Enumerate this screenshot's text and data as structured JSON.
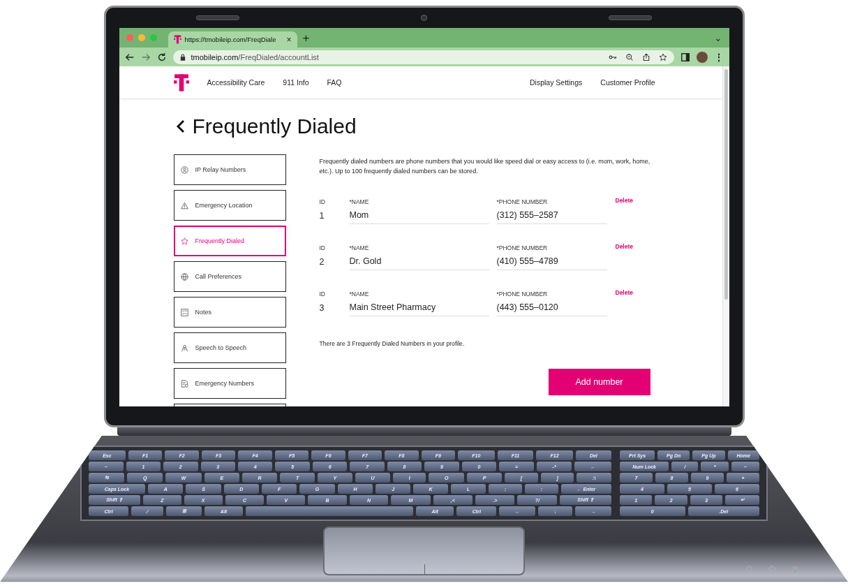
{
  "browser": {
    "tab": {
      "title": "https://tmobileip.com/FreqDiale",
      "close": "×"
    },
    "new_tab": "+",
    "tab_menu": "⌄",
    "address": {
      "domain": "tmobileip.com",
      "path": "/FreqDialed/accountList"
    },
    "menu": "⋮"
  },
  "nav": {
    "left": [
      "Accessibility Care",
      "911 Info",
      "FAQ"
    ],
    "right": [
      "Display Settings",
      "Customer Profile"
    ]
  },
  "page_title": "Frequently Dialed",
  "sidebar": {
    "items": [
      {
        "label": "IP Relay Numbers",
        "selected": false
      },
      {
        "label": "Emergency Location",
        "selected": false
      },
      {
        "label": "Frequently Dialed",
        "selected": true
      },
      {
        "label": "Call Preferences",
        "selected": false
      },
      {
        "label": "Notes",
        "selected": false
      },
      {
        "label": "Speech to Speech",
        "selected": false
      },
      {
        "label": "Emergency Numbers",
        "selected": false
      }
    ]
  },
  "description": "Frequently dialed numbers are phone numbers that you would like speed dial or easy access to (i.e. mom, work, home, etc.). Up to 100 frequently dialed numbers can be stored.",
  "rows": [
    {
      "id_label": "ID",
      "id": "1",
      "name_label": "*NAME",
      "name": "Mom",
      "phone_label": "*PHONE NUMBER",
      "phone": "(312) 555–2587",
      "action": "Delete"
    },
    {
      "id_label": "ID",
      "id": "2",
      "name_label": "*NAME",
      "name": "Dr. Gold",
      "phone_label": "*PHONE NUMBER",
      "phone": "(410) 555–4789",
      "action": "Delete"
    },
    {
      "id_label": "ID",
      "id": "3",
      "name_label": "*NAME",
      "name": "Main Street Pharmacy",
      "phone_label": "*PHONE NUMBER",
      "phone": "(443) 555–0120",
      "action": "Delete"
    }
  ],
  "summary": "There are 3 Frequently Dialed Numbers in your profile.",
  "add_button": "Add number",
  "keyboard": {
    "main_rows": [
      [
        "Esc",
        "F1",
        "F2",
        "F3",
        "F4",
        "F5",
        "F6",
        "F7",
        "F8",
        "F9",
        "F10",
        "F11",
        "F12",
        "Del"
      ],
      [
        "~",
        "1",
        "2",
        "3",
        "4",
        "5",
        "6",
        "7",
        "8",
        "9",
        "0",
        "=",
        "-*",
        "←"
      ],
      [
        "⇆",
        "Q",
        "W",
        "E",
        "R",
        "T",
        "Y",
        "U",
        "I",
        "O",
        "P",
        "[",
        "]",
        ":\\"
      ],
      [
        "Caps Lock",
        "A",
        "S",
        "D",
        "F",
        "G",
        "H",
        "J",
        "K",
        "L",
        ":",
        ":",
        "← Enter"
      ],
      [
        "Shift ⇑",
        "Z",
        "X",
        "C",
        "V",
        "B",
        "N",
        "M",
        ",<",
        ".>",
        "?/",
        "Shift ⇑"
      ]
    ],
    "bottom_left": [
      "Ctrl",
      "⁄",
      "⊞",
      "Alt"
    ],
    "bottom_right": [
      "Alt",
      "Ctrl",
      "←",
      "↓",
      "→"
    ],
    "numpad_rows": [
      [
        "Prt Sys",
        "Pg Dn",
        "Pg Up",
        "Home"
      ],
      [
        "Num Lock",
        "/",
        "*",
        "−"
      ],
      [
        "7",
        "8",
        "9",
        "+"
      ],
      [
        "4",
        "5",
        "6"
      ],
      [
        "1",
        "2",
        "3",
        "↵"
      ],
      [
        "0",
        ".Del"
      ]
    ]
  }
}
